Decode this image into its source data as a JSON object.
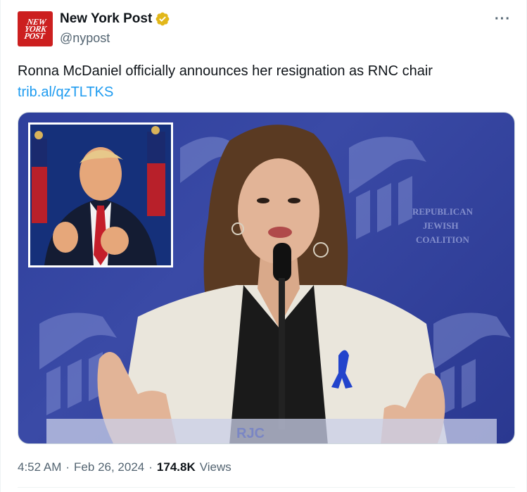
{
  "account": {
    "avatar_line1": "NEW",
    "avatar_line2": "YORK",
    "avatar_line3": "POST",
    "display_name": "New York Post",
    "handle": "@nypost",
    "verified_color": "#e2b719"
  },
  "menu": {
    "more_label": "···"
  },
  "tweet": {
    "text": "Ronna McDaniel officially announces her resignation as RNC chair",
    "link": "trib.al/qzTLTKS"
  },
  "media": {
    "backdrop_text_lines": [
      "REPUBLICAN",
      "JEWISH",
      "COALITION"
    ],
    "podium_text": "RJC",
    "background_color": "#2f3f9d"
  },
  "meta": {
    "time": "4:52 AM",
    "separator1": "·",
    "date": "Feb 26, 2024",
    "separator2": "·",
    "views_count": "174.8K",
    "views_label": "Views"
  }
}
